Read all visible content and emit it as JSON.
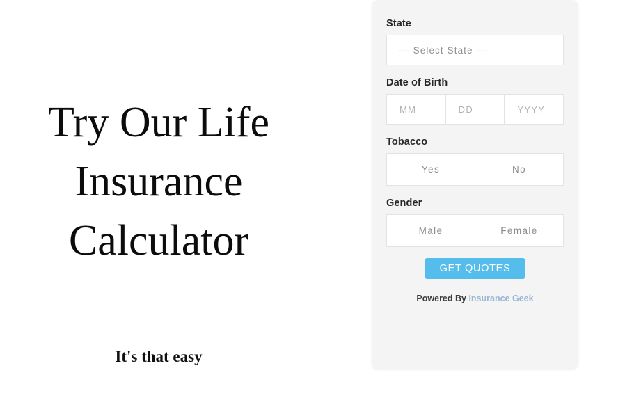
{
  "hero": {
    "title_lines": [
      "Try Our Life",
      "Insurance",
      "Calculator"
    ],
    "subtitle": "It's that easy"
  },
  "form": {
    "state": {
      "label": "State",
      "selected_value": "--- Select State ---"
    },
    "date_of_birth": {
      "label": "Date of Birth",
      "fields": [
        {
          "name": "month",
          "placeholder": "MM",
          "value": ""
        },
        {
          "name": "day",
          "placeholder": "DD",
          "value": ""
        },
        {
          "name": "year",
          "placeholder": "YYYY",
          "value": ""
        }
      ]
    },
    "tobacco": {
      "label": "Tobacco",
      "options": [
        "Yes",
        "No"
      ]
    },
    "gender": {
      "label": "Gender",
      "options": [
        "Male",
        "Female"
      ]
    },
    "submit_label": "GET QUOTES",
    "footer": {
      "prefix": "Powered By ",
      "brand": "Insurance Geek"
    }
  },
  "colors": {
    "page_background": "#ffffff",
    "card_background": "#f4f4f4",
    "input_background": "#ffffff",
    "input_border": "#e3e3e3",
    "label_text": "#262626",
    "placeholder_text": "#8f8f8f",
    "accent_button": "#54bdec",
    "button_text": "#ffffff",
    "brand_link": "#9ab6d6"
  }
}
